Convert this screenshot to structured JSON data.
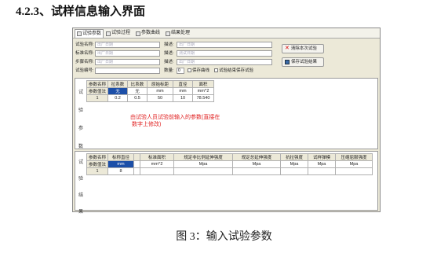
{
  "doc": {
    "heading": "4.2.3、试样信息输入界面",
    "caption": "图 3：输入试验参数"
  },
  "tabs": [
    {
      "label": "试验参数"
    },
    {
      "label": "试验过程"
    },
    {
      "label": "参数曲线"
    },
    {
      "label": "结果处理"
    }
  ],
  "form": {
    "name_label": "试验名称:",
    "name_ph": "出厂日期",
    "std_label": "标准名称:",
    "std_ph": "出厂日期",
    "step_label": "步骤名称:",
    "step_ph": "出厂日期",
    "id_label": "试验编号:",
    "desc1_label": "描述:",
    "desc1_ph": "出厂日期",
    "desc2_label": "描述:",
    "desc2_ph": "测试日期",
    "desc3_label": "描述:",
    "desc3_ph": "出厂日期",
    "count_label": "数量:",
    "count_value": "0",
    "opt1_label": "保存曲线",
    "opt2_label": "试验结束保存试验",
    "btn_clear": "清除本次试验",
    "btn_save": "保存试验结果"
  },
  "params": {
    "side": [
      "试",
      "验",
      "参",
      "数"
    ],
    "headers": [
      "参数名称",
      "拉系数",
      "比系数",
      "原始标距",
      "直径",
      "面积"
    ],
    "sel_header": "参数值法",
    "units_row": [
      "无",
      "无",
      "mm",
      "mm",
      "mm^2"
    ],
    "row_num": "1",
    "values": [
      "0.2",
      "0.5",
      "50",
      "10",
      "78.540"
    ],
    "note_l1": "由试验人员试验前输入的参数(直接在",
    "note_l2": "数字上修改)"
  },
  "results": {
    "side": [
      "试",
      "验",
      "结",
      "果"
    ],
    "headers": [
      "参数名称",
      "标称直径",
      "",
      "标准面积",
      "规定非比例延伸强度",
      "规定总延伸强度",
      "抗拉强度",
      "试样弹模",
      "压缩屈服强度"
    ],
    "sel_header": "参数值法",
    "units_row": [
      "mm",
      "",
      "mm^2",
      "Mpa",
      "Mpa",
      "Mpa",
      "Mpa",
      "Mpa"
    ],
    "row_num": "1",
    "values": [
      "8"
    ]
  }
}
